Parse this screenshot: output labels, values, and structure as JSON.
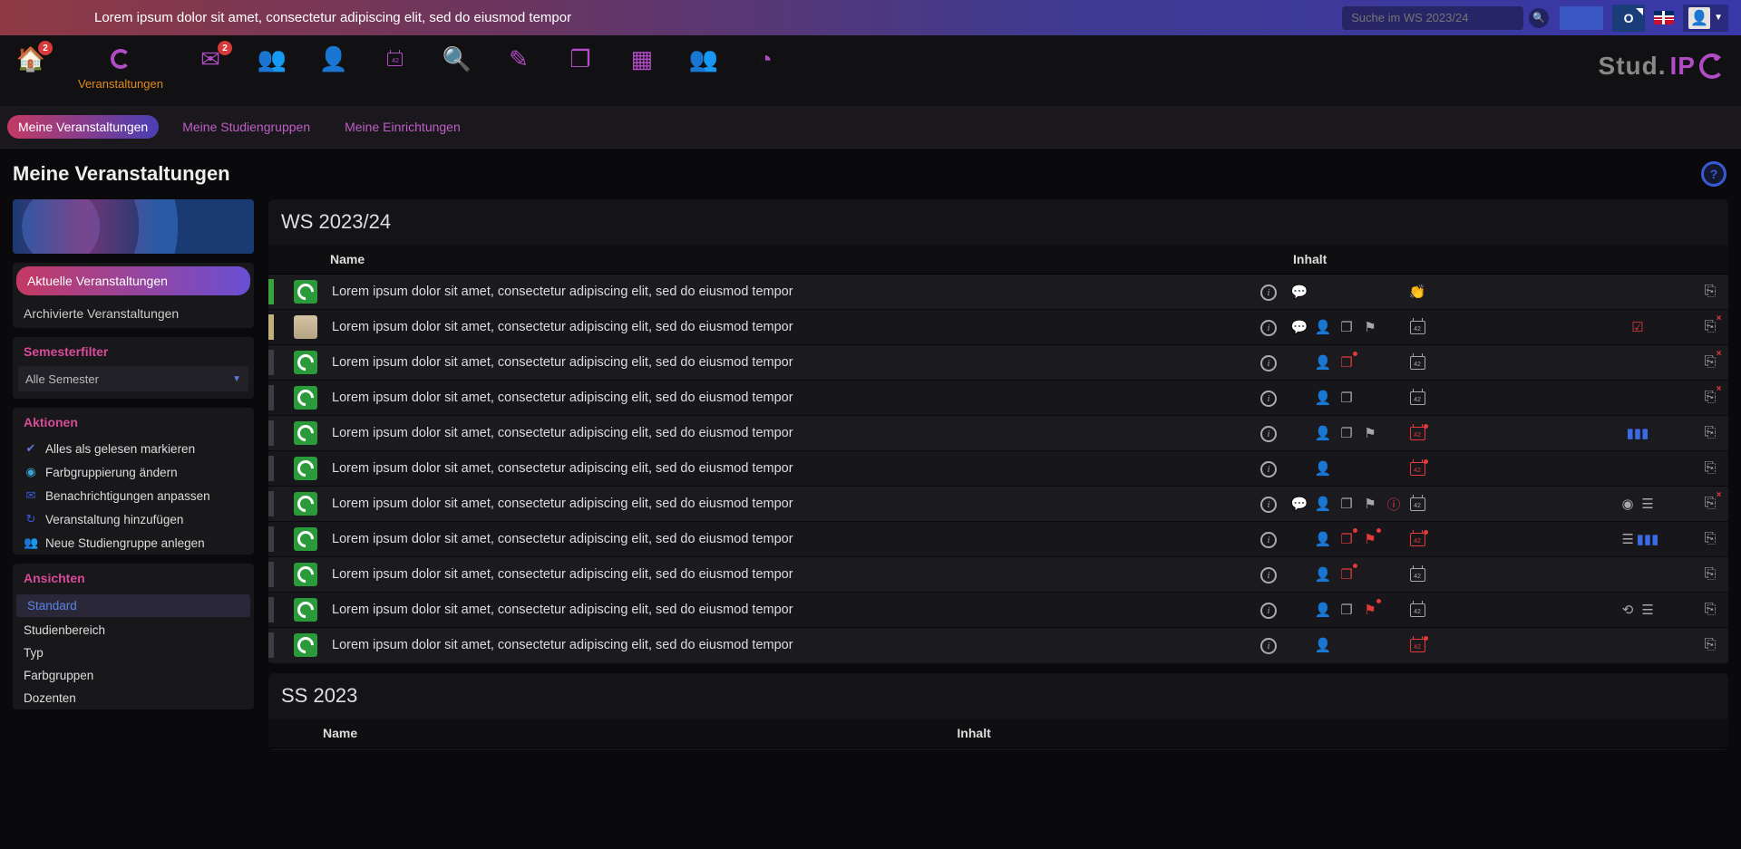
{
  "banner": {
    "text": "Lorem ipsum dolor sit amet, consectetur adipiscing elit, sed do eiusmod tempor"
  },
  "search": {
    "placeholder": "Suche im WS 2023/24"
  },
  "nav": {
    "home_badge": "2",
    "mail_badge": "2",
    "active_label": "Veranstaltungen"
  },
  "logo": {
    "text_a": "Stud.",
    "text_b": "IP"
  },
  "subtabs": {
    "my_courses": "Meine Veranstaltungen",
    "my_groups": "Meine Studiengruppen",
    "my_inst": "Meine Einrichtungen"
  },
  "page_title": "Meine Veranstaltungen",
  "sidebar": {
    "nav_group": {
      "current": "Aktuelle Veranstaltungen",
      "archived": "Archivierte Veranstaltungen"
    },
    "semfilter": {
      "title": "Semesterfilter",
      "value": "Alle Semester"
    },
    "actions": {
      "title": "Aktionen",
      "mark_read": "Alles als gelesen markieren",
      "color_group": "Farbgruppierung ändern",
      "notify": "Benachrichtigungen anpassen",
      "add_course": "Veranstaltung hinzufügen",
      "new_group": "Neue Studiengruppe anlegen"
    },
    "views": {
      "title": "Ansichten",
      "standard": "Standard",
      "study": "Studienbereich",
      "typ": "Typ",
      "color": "Farbgruppen",
      "dozent": "Dozenten"
    }
  },
  "semesters": {
    "ws": {
      "title": "WS 2023/24",
      "col_name": "Name",
      "col_content": "Inhalt"
    },
    "ss": {
      "title": "SS 2023",
      "col_name": "Name",
      "col_content": "Inhalt"
    }
  },
  "courses": [
    {
      "name": "Lorem ipsum dolor sit amet, consectetur adipiscing elit, sed do eiusmod tempor"
    },
    {
      "name": "Lorem ipsum dolor sit amet, consectetur adipiscing elit, sed do eiusmod tempor"
    },
    {
      "name": "Lorem ipsum dolor sit amet, consectetur adipiscing elit, sed do eiusmod tempor"
    },
    {
      "name": "Lorem ipsum dolor sit amet, consectetur adipiscing elit, sed do eiusmod tempor"
    },
    {
      "name": "Lorem ipsum dolor sit amet, consectetur adipiscing elit, sed do eiusmod tempor"
    },
    {
      "name": "Lorem ipsum dolor sit amet, consectetur adipiscing elit, sed do eiusmod tempor"
    },
    {
      "name": "Lorem ipsum dolor sit amet, consectetur adipiscing elit, sed do eiusmod tempor"
    },
    {
      "name": "Lorem ipsum dolor sit amet, consectetur adipiscing elit, sed do eiusmod tempor"
    },
    {
      "name": "Lorem ipsum dolor sit amet, consectetur adipiscing elit, sed do eiusmod tempor"
    },
    {
      "name": "Lorem ipsum dolor sit amet, consectetur adipiscing elit, sed do eiusmod tempor"
    },
    {
      "name": "Lorem ipsum dolor sit amet, consectetur adipiscing elit, sed do eiusmod tempor"
    }
  ]
}
